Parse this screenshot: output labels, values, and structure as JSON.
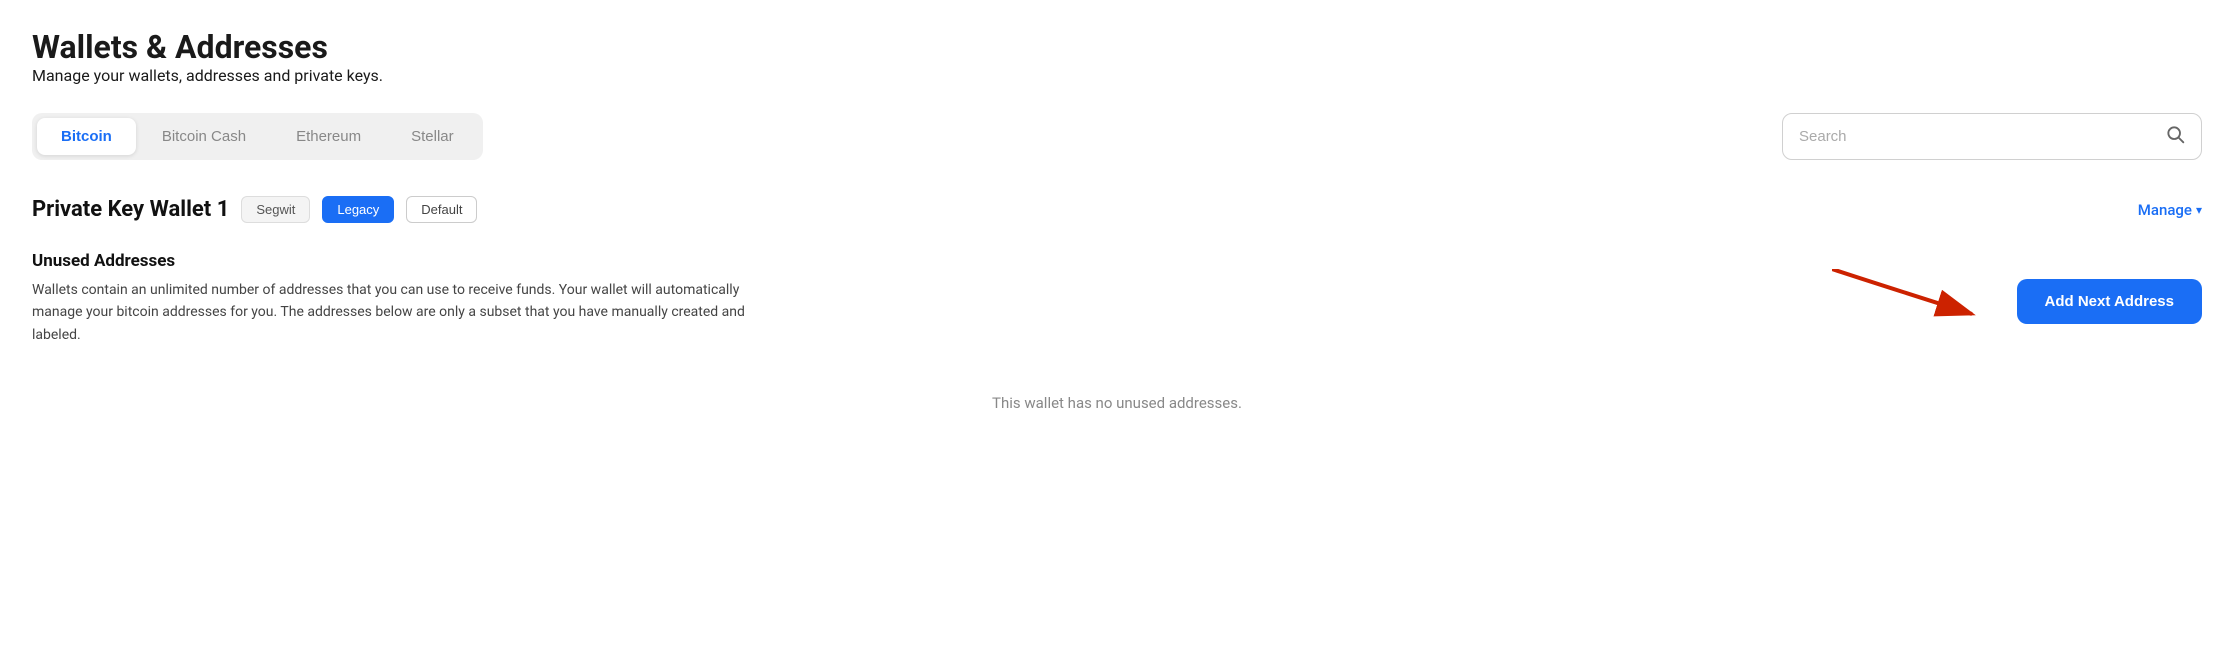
{
  "header": {
    "title": "Wallets & Addresses",
    "subtitle": "Manage your wallets, addresses and private keys."
  },
  "tabs": [
    {
      "label": "Bitcoin",
      "active": true
    },
    {
      "label": "Bitcoin Cash",
      "active": false
    },
    {
      "label": "Ethereum",
      "active": false
    },
    {
      "label": "Stellar",
      "active": false
    }
  ],
  "search": {
    "placeholder": "Search"
  },
  "wallet": {
    "name": "Private Key Wallet 1",
    "badges": [
      {
        "label": "Segwit",
        "type": "segwit"
      },
      {
        "label": "Legacy",
        "type": "legacy"
      },
      {
        "label": "Default",
        "type": "default"
      }
    ],
    "manage_label": "Manage",
    "unused_addresses": {
      "title": "Unused Addresses",
      "description": "Wallets contain an unlimited number of addresses that you can use to receive funds. Your wallet will automatically manage your bitcoin addresses for you. The addresses below are only a subset that you have manually created and labeled.",
      "add_button": "Add Next Address",
      "empty_state": "This wallet has no unused addresses."
    }
  }
}
